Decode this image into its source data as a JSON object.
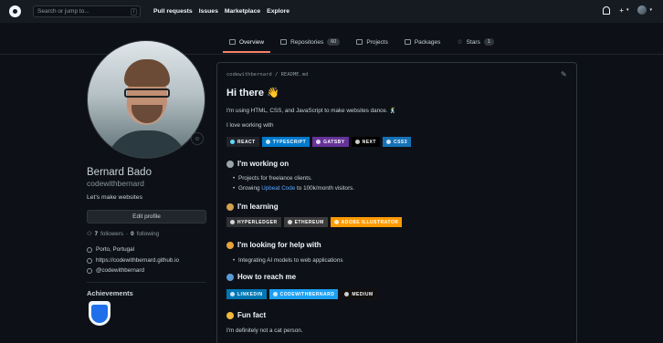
{
  "header": {
    "search_placeholder": "Search or jump to...",
    "search_key": "/",
    "nav": [
      "Pull requests",
      "Issues",
      "Marketplace",
      "Explore"
    ],
    "plus": "+",
    "caret": "▾"
  },
  "tabs": [
    {
      "label": "Overview",
      "active": true
    },
    {
      "label": "Repositories",
      "count": "60"
    },
    {
      "label": "Projects"
    },
    {
      "label": "Packages"
    },
    {
      "label": "Stars",
      "count": "1"
    }
  ],
  "profile": {
    "name": "Bernard Bado",
    "username": "codewithbernard",
    "bio": "Let's make websites",
    "edit_label": "Edit profile",
    "followers": "7",
    "followers_label": "followers",
    "dot": "·",
    "following": "0",
    "following_label": "following",
    "location": "Porto, Portugal",
    "website": "https://codewithbernard.github.io",
    "twitter": "@codewithbernard",
    "achievements_title": "Achievements"
  },
  "readme": {
    "filename": "codewithbernard / README.md",
    "title": "Hi there 👋",
    "intro": "I'm using HTML, CSS, and JavaScript to make websites dance. 🕺",
    "love": "I love working with",
    "tech_badges": [
      {
        "label": "REACT",
        "color": "#20232a"
      },
      {
        "label": "TYPESCRIPT",
        "color": "#007acc"
      },
      {
        "label": "GATSBY",
        "color": "#663399"
      },
      {
        "label": "NEXT",
        "color": "#000000"
      },
      {
        "label": "CSS3",
        "color": "#1572b6"
      }
    ],
    "working_title": "I'm working on",
    "working_items": [
      "Projects for freelance clients.",
      "Growing ",
      "Upbeat Code",
      " to 100k/month visitors."
    ],
    "learning_title": "I'm learning",
    "learning_badges": [
      {
        "label": "HYPERLEDGER",
        "color": "#2f3134"
      },
      {
        "label": "ETHEREUM",
        "color": "#3c3c3d"
      },
      {
        "label": "ADOBE ILLUSTRATOR",
        "color": "#ff9a00"
      }
    ],
    "help_title": "I'm looking for help with",
    "help_items": [
      "Integrating AI models to web applications"
    ],
    "reach_title": "How to reach me",
    "reach_badges": [
      {
        "label": "LINKEDIN",
        "color": "#0077b5"
      },
      {
        "label": "CODEWITHBERNARD",
        "color": "#1ca0f2"
      },
      {
        "label": "MEDIUM",
        "color": "#12100e"
      }
    ],
    "fun_title": "Fun fact",
    "fun_text": "I'm definitely not a cat person."
  }
}
